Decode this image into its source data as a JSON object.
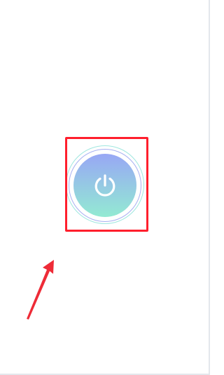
{
  "screen": {
    "background": "#ffffff"
  },
  "power_button": {
    "icon": "power-icon",
    "gradient_top": "#98a7f5",
    "gradient_bottom": "#93ead3",
    "outer_ring_color": "#9fe7df",
    "inner_ring_color": "#a7b0f1"
  },
  "annotation": {
    "highlight_color": "#ff1f2d",
    "arrow_color": "#ee2b37"
  }
}
